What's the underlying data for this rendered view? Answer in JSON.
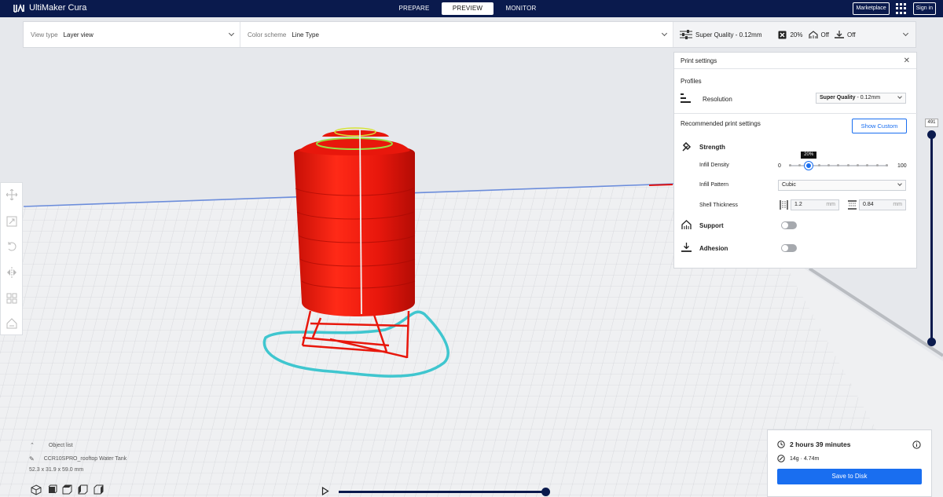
{
  "app": {
    "name": "UltiMaker Cura"
  },
  "stages": [
    {
      "label": "PREPARE",
      "active": false
    },
    {
      "label": "PREVIEW",
      "active": true
    },
    {
      "label": "MONITOR",
      "active": false
    }
  ],
  "header": {
    "marketplace": "Marketplace",
    "signin": "Sign in"
  },
  "toolbar": {
    "view_type_label": "View type",
    "view_type_value": "Layer view",
    "color_scheme_label": "Color scheme",
    "color_scheme_value": "Line Type",
    "profile": "Super Quality - 0.12mm",
    "infill": "20%",
    "support": "Off",
    "adhesion": "Off"
  },
  "panel": {
    "title": "Print settings",
    "profiles_heading": "Profiles",
    "resolution_label": "Resolution",
    "resolution_bold": "Super Quality",
    "resolution_rest": " - 0.12mm",
    "recommended_heading": "Recommended print settings",
    "show_custom": "Show Custom",
    "strength": "Strength",
    "infill_density_label": "Infill Density",
    "infill_min": "0",
    "infill_max": "100",
    "infill_value": "20%",
    "infill_fraction": 0.2,
    "infill_pattern_label": "Infill Pattern",
    "infill_pattern_value": "Cubic",
    "shell_thickness_label": "Shell Thickness",
    "wall_value": "1.2",
    "top_bottom_value": "0.84",
    "unit": "mm",
    "support": "Support",
    "adhesion": "Adhesion"
  },
  "layer_slider": {
    "value": "491"
  },
  "object_list": {
    "heading": "Object list",
    "object_name": "CCR10SPRO_rooftop Water Tank",
    "dimensions": "52.3 x 31.9 x 59.0 mm"
  },
  "print_info": {
    "time": "2 hours 39 minutes",
    "material": "14g · 4.74m",
    "save_label": "Save to Disk"
  },
  "colors": {
    "header_bg": "#0a1a4d",
    "accent": "#196ef0",
    "model_red": "#e8170c",
    "skirt": "#3fc6cf"
  }
}
